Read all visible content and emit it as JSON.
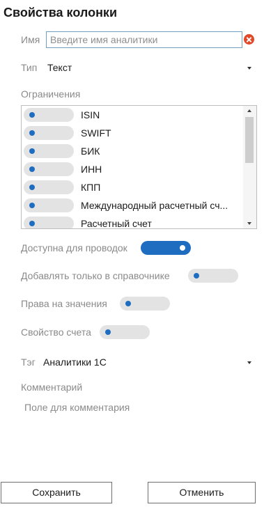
{
  "title": "Свойства колонки",
  "name_field": {
    "label": "Имя",
    "value": "",
    "placeholder": "Введите имя аналитики"
  },
  "type_field": {
    "label": "Тип",
    "value": "Текст"
  },
  "constraints": {
    "label": "Ограничения",
    "items": [
      {
        "label": "ISIN",
        "enabled": false
      },
      {
        "label": "SWIFT",
        "enabled": false
      },
      {
        "label": "БИК",
        "enabled": false
      },
      {
        "label": "ИНН",
        "enabled": false
      },
      {
        "label": "КПП",
        "enabled": false
      },
      {
        "label": "Международный расчетный сч...",
        "enabled": false
      },
      {
        "label": "Расчетный счет",
        "enabled": false
      }
    ]
  },
  "toggles": {
    "postings": {
      "label": "Доступна для проводок",
      "enabled": true
    },
    "directory_only": {
      "label": "Добавлять только в справочнике",
      "enabled": false
    },
    "value_rights": {
      "label": "Права на значения",
      "enabled": false
    },
    "account_property": {
      "label": "Свойство счета",
      "enabled": false
    }
  },
  "tag_field": {
    "label": "Тэг",
    "value": "Аналитики 1С"
  },
  "comment": {
    "label": "Комментарий",
    "placeholder": "Поле для комментария"
  },
  "buttons": {
    "save": "Сохранить",
    "cancel": "Отменить"
  },
  "colors": {
    "accent": "#1f6dc1",
    "toggle_off": "#e3e3e3",
    "clear_icon": "#e04a2a",
    "input_border": "#6d9ec2"
  }
}
